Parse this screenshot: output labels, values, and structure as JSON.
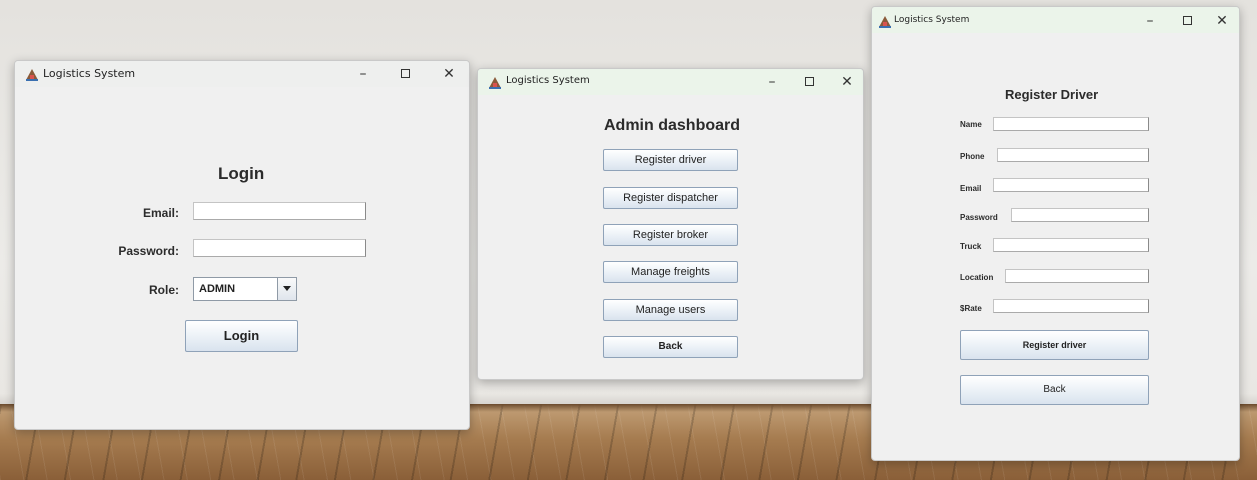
{
  "login_window": {
    "title": "Logistics System",
    "heading": "Login",
    "email_label": "Email:",
    "email_value": "",
    "password_label": "Password:",
    "password_value": "",
    "role_label": "Role:",
    "role_selected": "ADMIN",
    "login_button": "Login"
  },
  "admin_window": {
    "title": "Logistics System",
    "heading": "Admin dashboard",
    "buttons": [
      "Register driver",
      "Register dispatcher",
      "Register broker",
      "Manage freights",
      "Manage users",
      "Back"
    ]
  },
  "driver_window": {
    "title": "Logistics System",
    "heading": "Register Driver",
    "fields": [
      {
        "label": "Name",
        "value": ""
      },
      {
        "label": "Phone",
        "value": ""
      },
      {
        "label": "Email",
        "value": ""
      },
      {
        "label": "Password",
        "value": ""
      },
      {
        "label": "Truck",
        "value": ""
      },
      {
        "label": "Location",
        "value": ""
      },
      {
        "label": "$Rate",
        "value": ""
      }
    ],
    "register_button": "Register driver",
    "back_button": "Back"
  },
  "window_controls": {
    "minimize": "–",
    "close": "✕"
  },
  "colors": {
    "window_bg": "#f0f0f0",
    "button_gradient_end": "#d9e3ee",
    "titlebar_tint": "#ebf4ea"
  }
}
